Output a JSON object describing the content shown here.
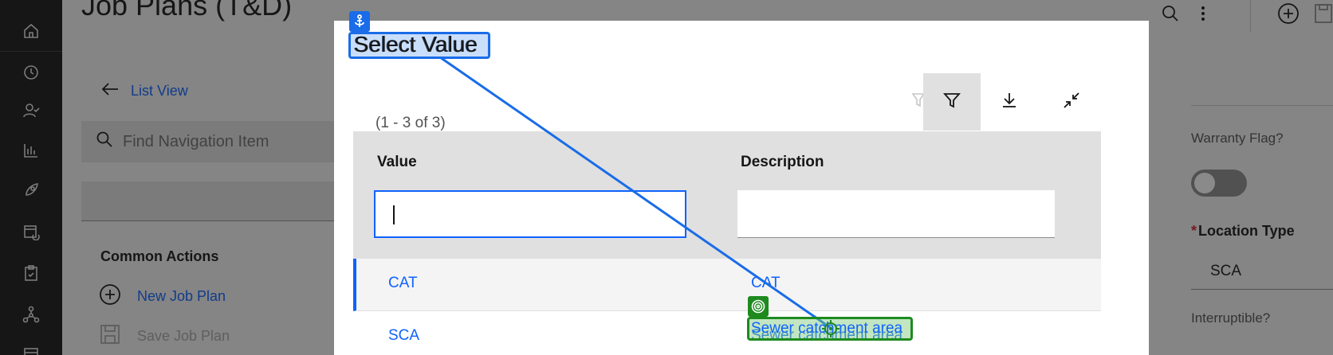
{
  "app": {
    "page_title": "Job Plans (T&D)"
  },
  "rail": {
    "icons": [
      "home-icon",
      "history-icon",
      "user-check-icon",
      "chart-icon",
      "rocket-icon",
      "calendar-sync-icon",
      "clipboard-icon",
      "tree-icon",
      "calendar-icon"
    ]
  },
  "nav": {
    "back_label": "List View",
    "search_placeholder": "Find Navigation Item",
    "common_actions_title": "Common Actions",
    "new_job_plan": "New Job Plan",
    "save_job_plan": "Save Job Plan"
  },
  "right_panel": {
    "warranty_label": "Warranty Flag?",
    "warranty_on": false,
    "location_type_label": "Location Type",
    "location_type_value": "SCA",
    "interruptible_label": "Interruptible?"
  },
  "modal": {
    "title": "Select Value",
    "count": "(1 - 3 of 3)",
    "toolbar": {
      "clear_filter": "clear-filter-icon",
      "filter": "filter-icon",
      "download": "download-icon",
      "collapse": "collapse-icon"
    },
    "columns": [
      "Value",
      "Description"
    ],
    "filter_values": [
      "",
      ""
    ],
    "rows": [
      {
        "value": "CAT",
        "description": "CAT"
      },
      {
        "value": "SCA",
        "description": "Sewer catchment area"
      }
    ]
  },
  "annotation": {
    "source_label": "Select Value",
    "target_label": "Sewer catchment area",
    "source_color": "#1a6ce8",
    "target_color": "#1e8a1e"
  }
}
